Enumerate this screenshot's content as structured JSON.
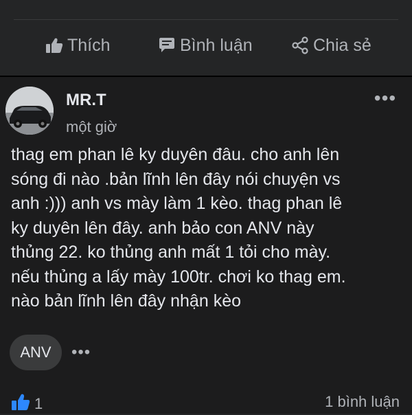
{
  "actions": {
    "like_label": "Thích",
    "comment_label": "Bình luận",
    "share_label": "Chia sẻ"
  },
  "post": {
    "author": "MR.T",
    "time": "một giờ",
    "more_glyph": "•••",
    "body": "thag em phan lê ky duyên đâu. cho anh lên\nsóng đi nào .bản lĩnh lên đây nói chuyện vs\nanh :))) anh vs mày làm 1 kèo. thag phan lê\nky duyên lên đây. anh bảo con ANV này\nthủng 22. ko thủng anh mất 1 tỏi cho mày.\nnếu thủng a lấy mày 100tr. chơi ko thag em.\nnào bản lĩnh lên đây nhận kèo",
    "tag": "ANV",
    "tag_more_glyph": "•••",
    "reaction_count": "1",
    "comment_count": "1 bình luận"
  },
  "colors": {
    "background": "#242526",
    "card": "#1c1c1d",
    "text": "#e4e6eb",
    "muted": "#b0b3b8",
    "accent": "#2d88ff"
  }
}
